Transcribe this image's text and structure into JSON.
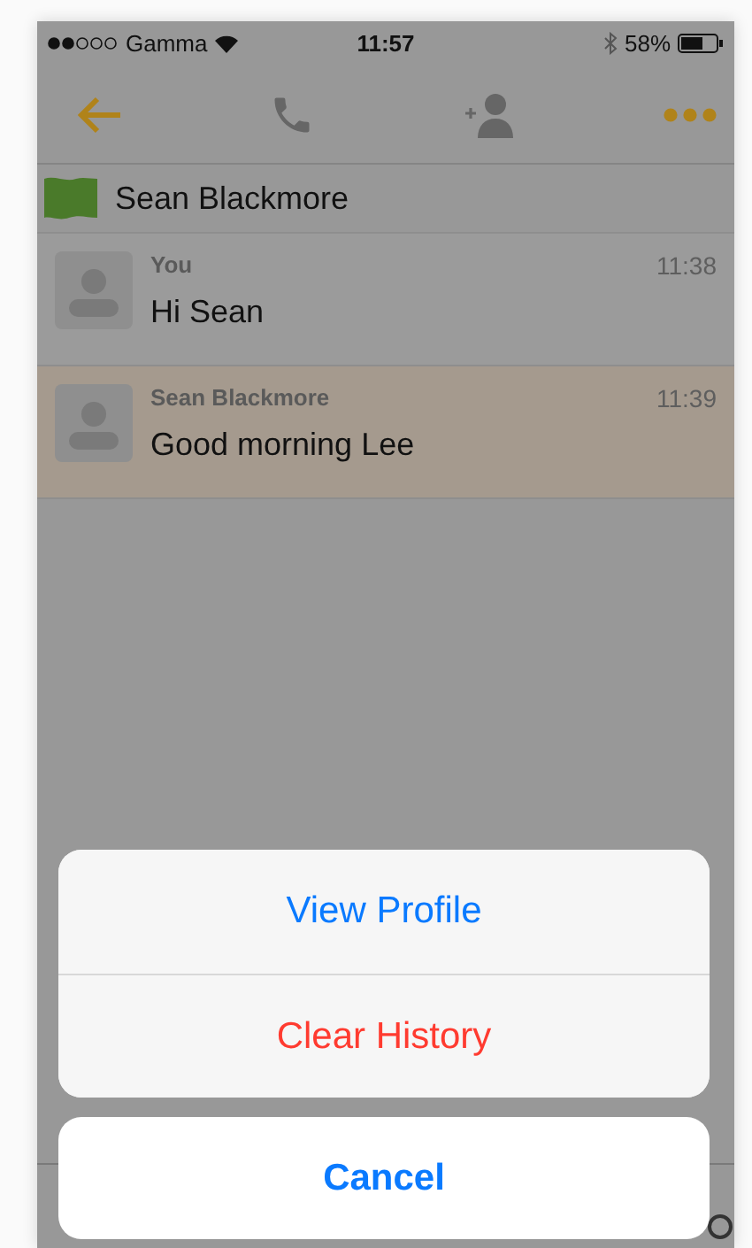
{
  "status_bar": {
    "carrier": "Gamma",
    "time": "11:57",
    "battery": "58%"
  },
  "contact": {
    "name": "Sean Blackmore"
  },
  "messages": [
    {
      "sender": "You",
      "time": "11:38",
      "text": "Hi Sean",
      "selected": false
    },
    {
      "sender": "Sean Blackmore",
      "time": "11:39",
      "text": "Good morning Lee",
      "selected": true
    }
  ],
  "action_sheet": {
    "actions": [
      {
        "label": "View Profile",
        "kind": "default"
      },
      {
        "label": "Clear History",
        "kind": "destructive"
      }
    ],
    "cancel": "Cancel"
  }
}
